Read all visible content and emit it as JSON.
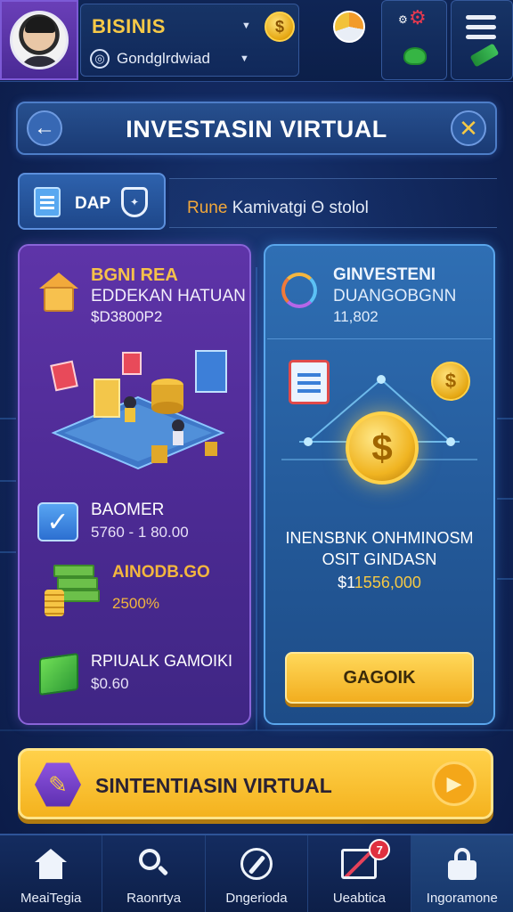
{
  "header": {
    "profile_name": "BISINIS",
    "profile_sub": "Gondglrdwiad",
    "coin_symbol": "$"
  },
  "titlebar": {
    "title": "INVESTASIN VIRTUAL",
    "back_symbol": "←",
    "close_symbol": "✕"
  },
  "toolbar": {
    "dap_label": "DAP",
    "info_highlight": "Rune",
    "info_rest": " Kamivatgi Θ stolol"
  },
  "left_card": {
    "title1": "BGNI REA",
    "title2": "EDDEKAN HATUAN",
    "title3": "$D3800P2",
    "balance_title": "BAOMER",
    "balance_value": "5760 - 1 80.00",
    "gold_title": "AINODB.GO",
    "gold_value": "2500%",
    "last_title": "RPIUALK GAMOIKI",
    "last_value": "$0.60"
  },
  "right_card": {
    "title1": "GINVESTENI",
    "title2": "DUANGOBGNN",
    "title3": "11,802",
    "mid_line1": "INENSBNK ONHMINOSM",
    "mid_line2": "OSIT GINDASN",
    "mid_line3_prefix": "$1",
    "mid_line3_highlight": "1556,000",
    "coin_symbol": "$",
    "button_label": "GAGOIK"
  },
  "banner": {
    "label": "SINTENTIASIN VIRTUAL"
  },
  "bottom_nav": {
    "items": [
      {
        "label": "MeaiTegia",
        "icon": "home-icon"
      },
      {
        "label": "Raonrtya",
        "icon": "search-icon"
      },
      {
        "label": "Dngerioda",
        "icon": "compass-icon"
      },
      {
        "label": "Ueabtica",
        "icon": "chart-icon",
        "badge": "7"
      },
      {
        "label": "Ingoramone",
        "icon": "lock-icon"
      }
    ]
  },
  "colors": {
    "accent_gold": "#f6c945",
    "card_purple": "#5e34a8",
    "card_blue": "#2f6fb4",
    "background": "#12295f"
  }
}
